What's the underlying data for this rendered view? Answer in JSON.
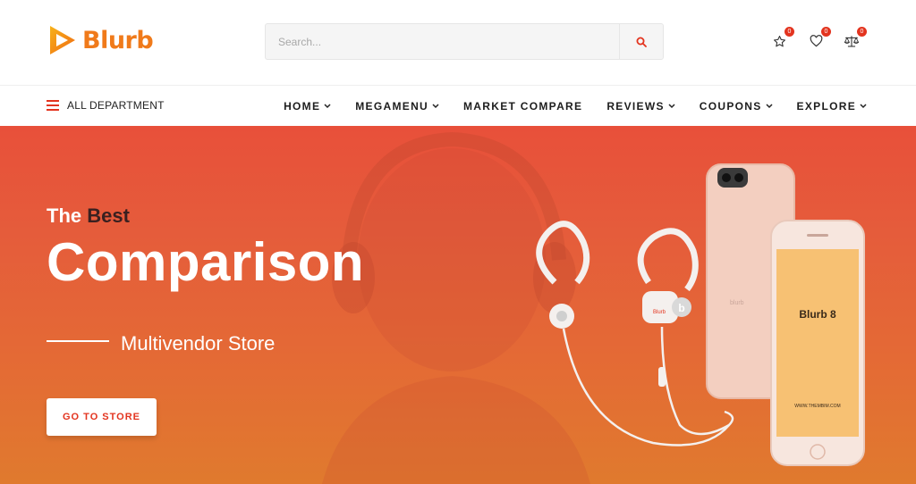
{
  "brand": {
    "name": "Blurb",
    "accent": "#f07a1a",
    "primary": "#e3341f"
  },
  "search": {
    "placeholder": "Search...",
    "icon": "search-icon"
  },
  "header_icons": [
    {
      "icon": "star-icon",
      "count": "0"
    },
    {
      "icon": "heart-icon",
      "count": "0"
    },
    {
      "icon": "compare-scale-icon",
      "count": "0"
    }
  ],
  "nav": {
    "department_label": "ALL DEPARTMENT",
    "menu": [
      {
        "label": "HOME",
        "has_dropdown": true
      },
      {
        "label": "MEGAMENU",
        "has_dropdown": true
      },
      {
        "label": "MARKET COMPARE",
        "has_dropdown": false
      },
      {
        "label": "REVIEWS",
        "has_dropdown": true
      },
      {
        "label": "COUPONS",
        "has_dropdown": true
      },
      {
        "label": "EXPLORE",
        "has_dropdown": true
      }
    ]
  },
  "hero": {
    "pre_word1": "The",
    "pre_word2": "Best",
    "title": "Comparison",
    "subtitle": "Multivendor Store",
    "cta": "GO TO STORE",
    "phone_screen_text": "Blurb 8",
    "phone_screen_url": "WWW.THEMBIM.COM",
    "earphone_mark": "b",
    "earphone_text": "Blurb"
  }
}
